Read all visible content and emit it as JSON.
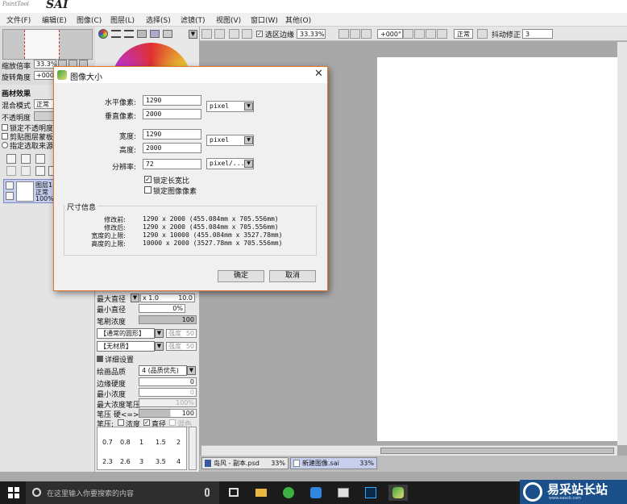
{
  "app": {
    "logo_small": "PaintTool",
    "logo_big": "SAI"
  },
  "menu": [
    "文件(F)",
    "编辑(E)",
    "图像(C)",
    "图层(L)",
    "选择(S)",
    "滤镜(T)",
    "视图(V)",
    "窗口(W)",
    "其他(O)"
  ],
  "navigator": {
    "zoom_label": "缩放倍率",
    "zoom_value": "33.3%",
    "rotate_label": "旋转角度",
    "rotate_value": "+000"
  },
  "layer_panel": {
    "effects_header": "画材效果",
    "blend_label": "混合模式",
    "blend_value": "正常",
    "opacity_label": "不透明度",
    "lock_opacity": "锁定不透明度",
    "clip_group": "剪贴图层蒙板",
    "selection_source": "指定选取来源",
    "layer_name": "图层1",
    "layer_mode": "正常",
    "layer_opacity": "100%"
  },
  "toolbar": {
    "selection_edge": "选区边缘",
    "zoom": "33.33%",
    "rotation": "+000°",
    "blend": "正常",
    "stabilizer_label": "抖动修正",
    "stabilizer_value": "3"
  },
  "tool_panel": {
    "max_diameter_label": "最大直径",
    "max_diameter_mult": "x 1.0",
    "max_diameter_value": "10.0",
    "min_diameter_label": "最小直径",
    "min_diameter_value": "0%",
    "density_label": "笔刷浓度",
    "density_value": "100",
    "shape_select": "【通常的圆形】",
    "shape_strength_label": "强度",
    "shape_strength_value": "50",
    "texture_select": "【无材质】",
    "texture_strength_label": "强度",
    "texture_strength_value": "50",
    "advanced_header": "详细设置",
    "quality_label": "绘画品质",
    "quality_value": "4 (品质优先)",
    "edge_hardness_label": "边缘硬度",
    "edge_hardness_value": "0",
    "min_density_label": "最小浓度",
    "min_density_value": "0",
    "max_density_pressure_label": "最大浓度笔压",
    "max_density_pressure_value": "100%",
    "pressure_label": "笔压 硬<=>软",
    "pressure_value": "100",
    "pressure_opts_label": "笔压:",
    "pressure_density": "浓度",
    "pressure_diameter": "直径",
    "pressure_blend": "混色",
    "brush_sizes": [
      "0.7",
      "0.8",
      "1",
      "1.5",
      "2",
      "2.3",
      "2.6",
      "3",
      "3.5",
      "4"
    ]
  },
  "dialog": {
    "title": "图像大小",
    "width_label": "水平像素:",
    "width_value": "1290",
    "height_label": "垂直像素:",
    "height_value": "2000",
    "pixel_unit_1": "pixel",
    "w2_label": "宽度:",
    "w2_value": "1290",
    "h2_label": "高度:",
    "h2_value": "2000",
    "pixel_unit_2": "pixel",
    "resolution_label": "分辨率:",
    "resolution_value": "72",
    "resolution_unit": "pixel/...",
    "lock_aspect": "锁定长宽比",
    "lock_pixels": "锁定图像像素",
    "size_info_title": "尺寸信息",
    "size_info": [
      {
        "label": "修改前:",
        "value": "1290 x 2000 (455.084mm x 705.556mm)"
      },
      {
        "label": "修改后:",
        "value": "1290 x 2000 (455.084mm x 705.556mm)"
      },
      {
        "label": "宽度的上限:",
        "value": "1290 x 10000 (455.084mm x 3527.78mm)"
      },
      {
        "label": "高度的上限:",
        "value": "10000 x 2000 (3527.78mm x 705.556mm)"
      }
    ],
    "ok": "确定",
    "cancel": "取消"
  },
  "documents": [
    {
      "name": "岛风 - 副本.psd",
      "zoom": "33%"
    },
    {
      "name": "新建图像.sai",
      "zoom": "33%"
    }
  ],
  "taskbar": {
    "search_placeholder": "在这里输入你要搜索的内容"
  },
  "watermark": {
    "title": "易采站长站",
    "subtitle": "www.easck.com"
  },
  "colors": {
    "dialog_border": "#e07a30",
    "layer_selected": "#c6cfee",
    "taskbar": "#1b1b1b"
  }
}
